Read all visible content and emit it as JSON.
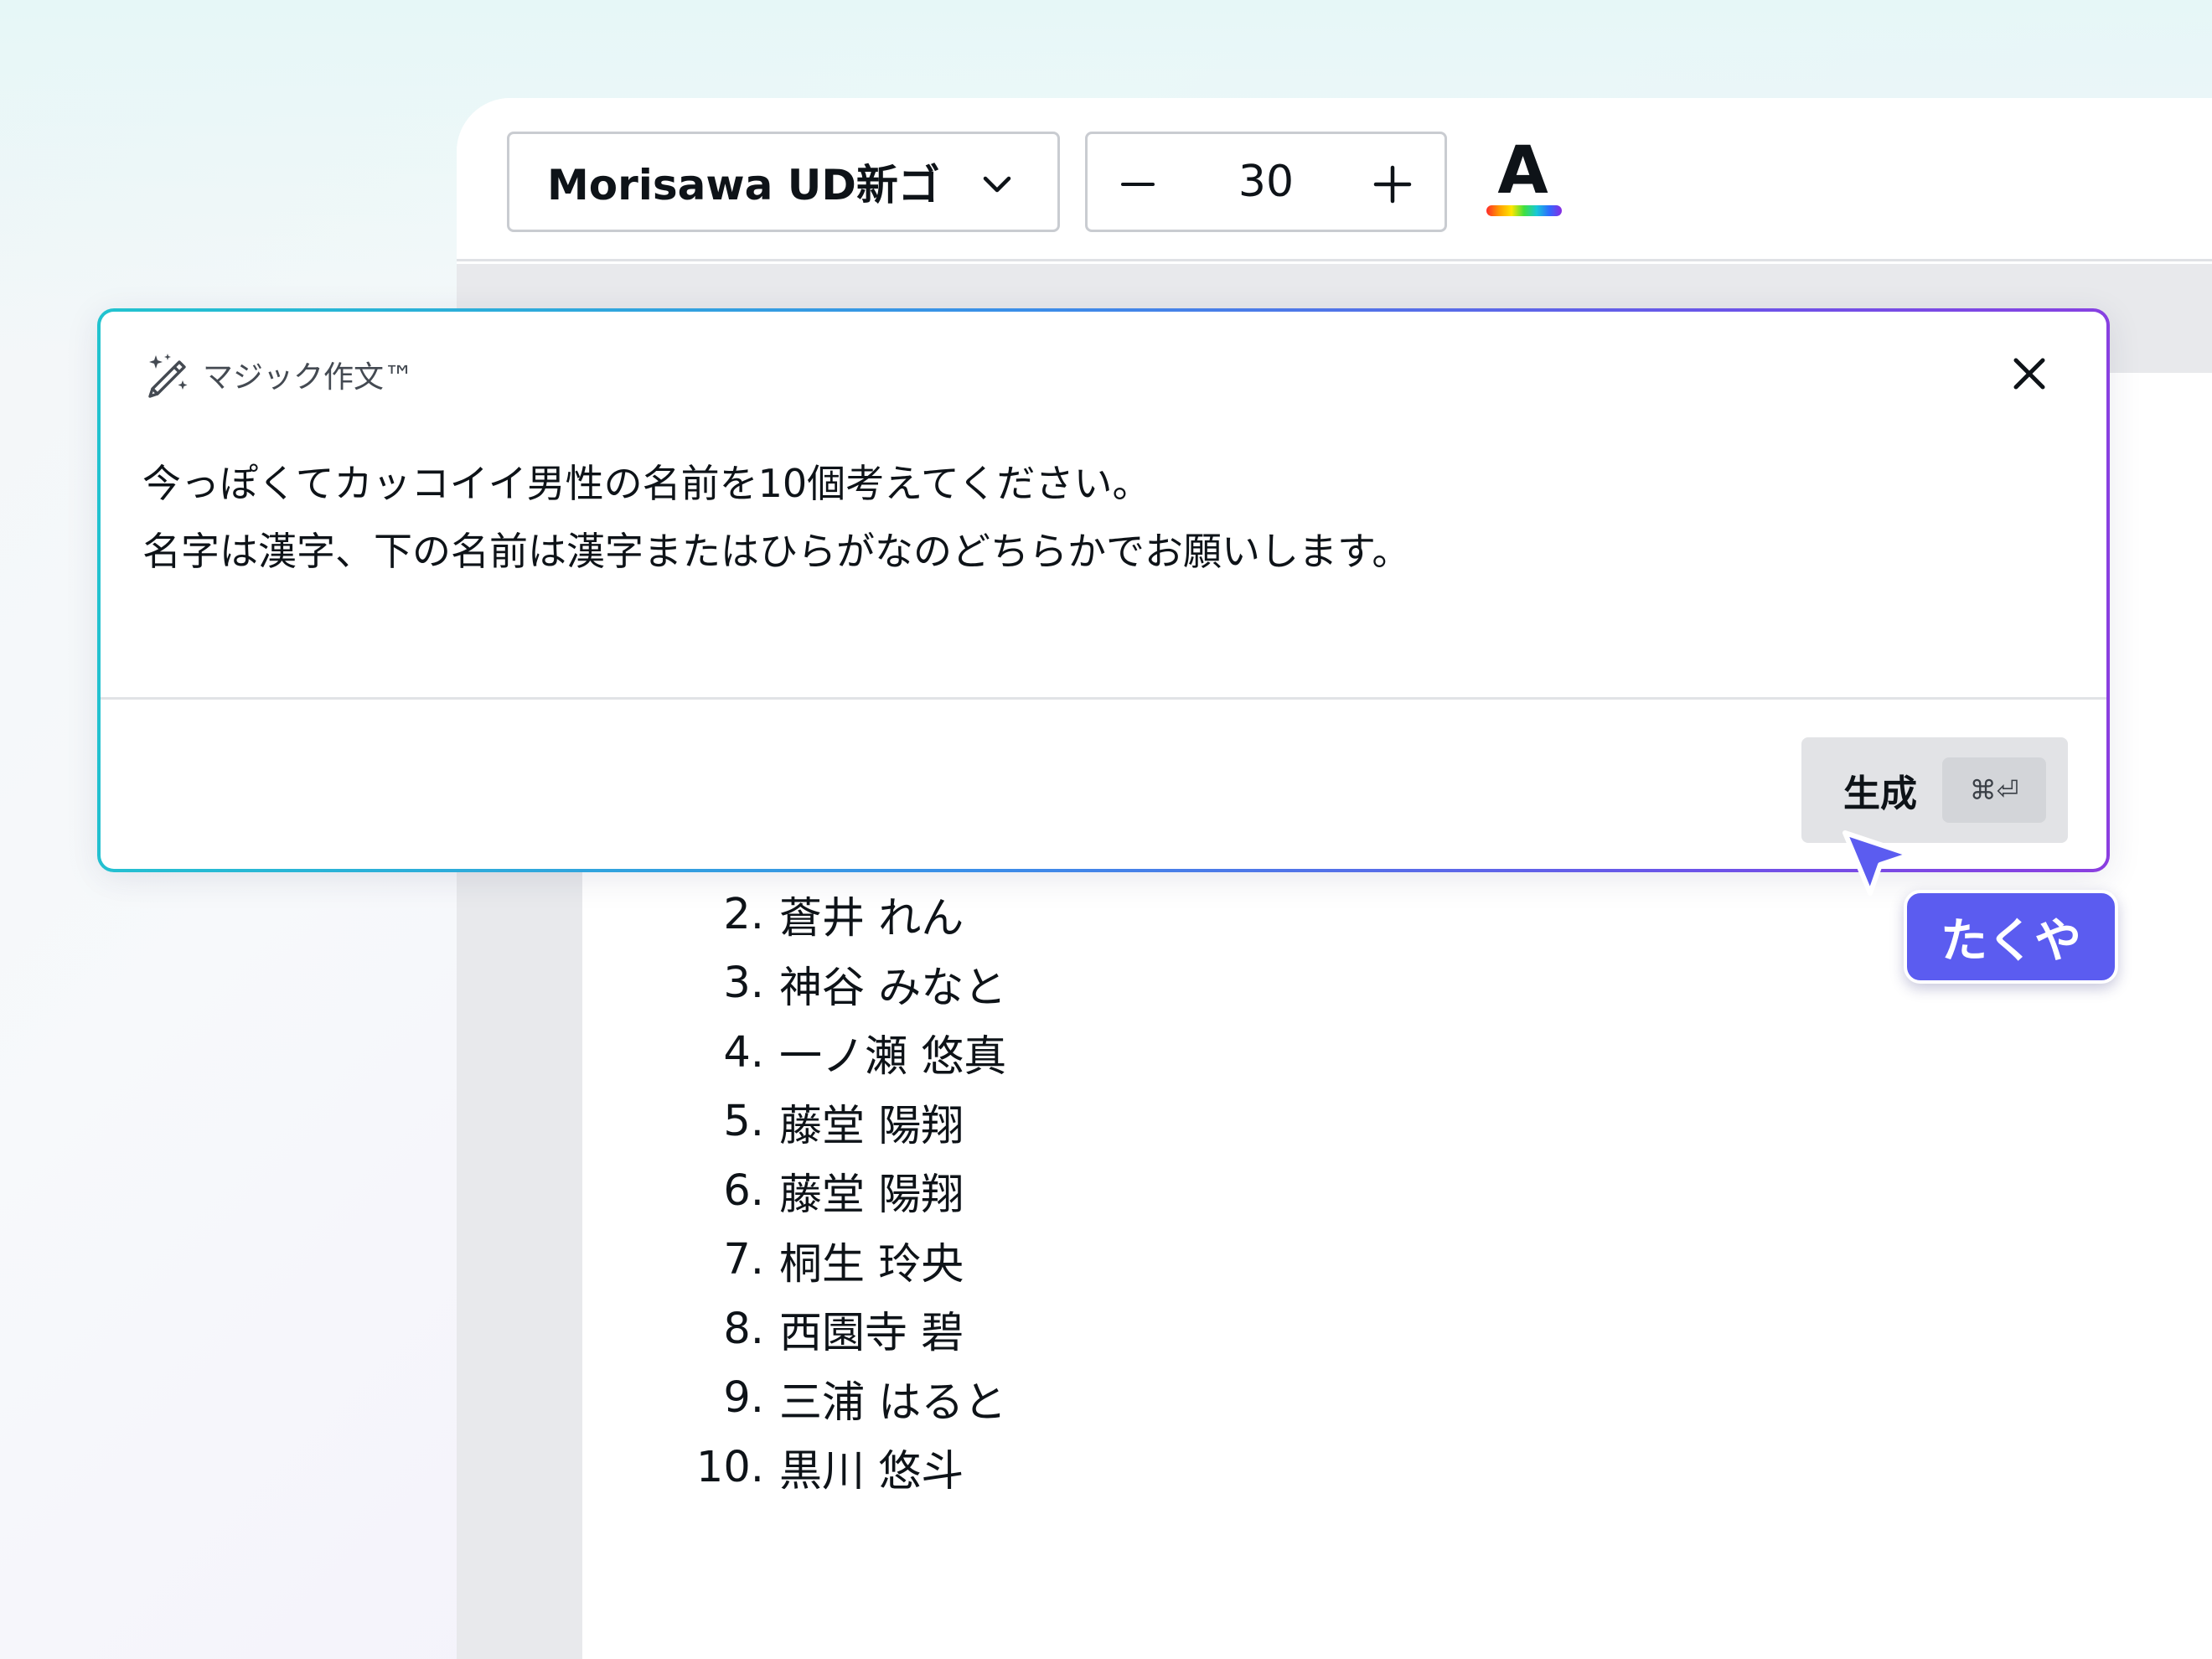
{
  "toolbar": {
    "font_name": "Morisawa UD新ゴ",
    "font_size": "30",
    "text_color_glyph": "A"
  },
  "magic_write": {
    "title": "マジック作文™",
    "prompt_line1": "今っぽくてカッコイイ男性の名前を10個考えてください。",
    "prompt_line2": "名字は漢字、下の名前は漢字またはひらがなのどちらかでお願いします。",
    "generate_label": "生成",
    "shortcut": "⌘⏎"
  },
  "results": [
    {
      "num": "2.",
      "name": "蒼井 れん"
    },
    {
      "num": "3.",
      "name": "神谷 みなと"
    },
    {
      "num": "4.",
      "name": "一ノ瀬 悠真"
    },
    {
      "num": "5.",
      "name": "藤堂 陽翔"
    },
    {
      "num": "6.",
      "name": "藤堂 陽翔"
    },
    {
      "num": "7.",
      "name": "桐生 玲央"
    },
    {
      "num": "8.",
      "name": "西園寺 碧"
    },
    {
      "num": "9.",
      "name": "三浦 はると"
    },
    {
      "num": "10.",
      "name": "黒川 悠斗"
    }
  ],
  "collaborator": {
    "name": "たくや",
    "color": "#5b5cf0"
  },
  "colors": {
    "panel_gradient_start": "#22c3cf",
    "panel_gradient_end": "#8b3ee0",
    "button_bg": "#e2e3e6"
  },
  "icons": {
    "dropdown": "chevron-down-icon",
    "decrease": "minus-icon",
    "increase": "plus-icon",
    "magic": "magic-wand-icon",
    "close": "close-icon",
    "cursor": "cursor-arrow-icon"
  }
}
